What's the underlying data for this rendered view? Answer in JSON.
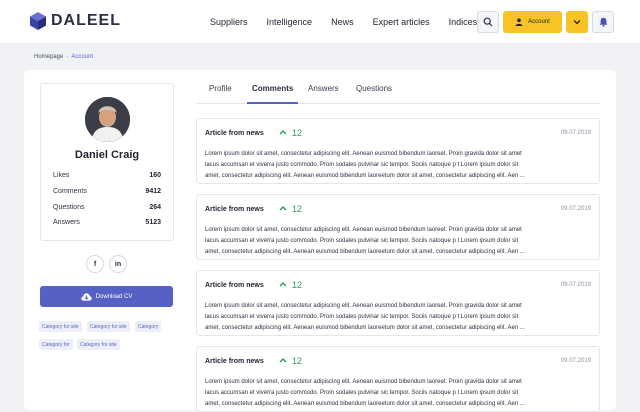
{
  "header": {
    "logo_text": "DALEEL",
    "nav": [
      "Suppliers",
      "Intelligence",
      "News",
      "Expert articles",
      "Indices"
    ],
    "account_label": "Account",
    "icons": {
      "search": "search-icon",
      "user": "user-icon",
      "dropdown": "chevron-down-icon",
      "notifications": "bell-icon"
    }
  },
  "breadcrumb": {
    "home": "Homepage",
    "separator": "-",
    "current": "Account"
  },
  "profile": {
    "name": "Daniel Craig",
    "stats": [
      {
        "label": "Likes",
        "value": "160"
      },
      {
        "label": "Comments",
        "value": "9412"
      },
      {
        "label": "Questions",
        "value": "264"
      },
      {
        "label": "Answers",
        "value": "5123"
      }
    ],
    "social": [
      "f",
      "in"
    ],
    "download_label": "Download CV",
    "tags": [
      "Category for site",
      "Category for site",
      "Category",
      "Category for",
      "Category for site"
    ]
  },
  "tabs": [
    "Profile",
    "Comments",
    "Answers",
    "Questions"
  ],
  "active_tab": "Comments",
  "comments": [
    {
      "title": "Article from news",
      "votes": "12",
      "date": "09.07.2019",
      "lines": [
        "Lorem ipsum dolor sit amet, consectetur adipiscing elit. Aenean euismod bibendum laoreet. Proin gravida dolor sit amet",
        "lacus accumsan et viverra justo commodo. Proin sodales pulvinar sic tempor. Sociis natoque p t Lorem ipsum dolor sit",
        "amet, consectetur adipiscing elit. Aenean euismod bibendum laoreetum dolor sit amet, consectetur adipiscing elit. Aen ..."
      ]
    },
    {
      "title": "Article from news",
      "votes": "12",
      "date": "09.07.2019",
      "lines": [
        "Lorem ipsum dolor sit amet, consectetur adipiscing elit. Aenean euismod bibendum laoreet. Proin gravida dolor sit amet",
        "lacus accumsan et viverra justo commodo. Proin sodales pulvinar sic tempor. Sociis natoque p t Lorem ipsum dolor sit",
        "amet, consectetur adipiscing elit. Aenean euismod bibendum laoreetum dolor sit amet, consectetur adipiscing elit. Aen ..."
      ]
    },
    {
      "title": "Article from news",
      "votes": "12",
      "date": "09.07.2019",
      "lines": [
        "Lorem ipsum dolor sit amet, consectetur adipiscing elit. Aenean euismod bibendum laoreet. Proin gravida dolor sit amet",
        "lacus accumsan et viverra justo commodo. Proin sodales pulvinar sic tempor. Sociis natoque p t Lorem ipsum dolor sit",
        "amet, consectetur adipiscing elit. Aenean euismod bibendum laoreetum dolor sit amet, consectetur adipiscing elit. Aen ..."
      ]
    },
    {
      "title": "Article from news",
      "votes": "12",
      "date": "09.07.2019",
      "lines": [
        "Lorem ipsum dolor sit amet, consectetur adipiscing elit. Aenean euismod bibendum laoreet. Proin gravida dolor sit amet",
        "lacus accumsan et viverra justo commodo. Proin sodales pulvinar sic tempor. Sociis natoque p t Lorem ipsum dolor sit",
        "amet, consectetur adipiscing elit. Aenean euismod bibendum laoreetum dolor sit amet, consectetur adipiscing elit. Aen ..."
      ]
    }
  ],
  "colors": {
    "accent": "#5760c4",
    "brand_yellow": "#f7c325",
    "vote_green": "#27a15a"
  }
}
